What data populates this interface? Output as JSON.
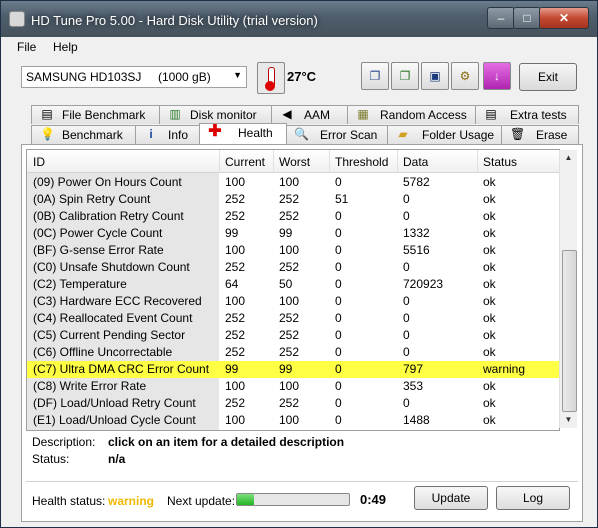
{
  "window": {
    "title": "HD Tune Pro 5.00 - Hard Disk Utility (trial version)",
    "controls": {
      "minimize": "–",
      "maximize": "□",
      "close": "✕"
    }
  },
  "menu": {
    "file": "File",
    "help": "Help"
  },
  "toolbar": {
    "drive": "SAMSUNG HD103SJ",
    "drive_size": "(1000 gB)",
    "temperature": "27°C",
    "exit_label": "Exit",
    "icons": [
      "copy-text-icon",
      "copy-screenshot-icon",
      "save-icon",
      "options-icon",
      "download-icon"
    ]
  },
  "tabs": {
    "top": [
      {
        "label": "File Benchmark",
        "icon": "file-benchmark-icon"
      },
      {
        "label": "Disk monitor",
        "icon": "disk-monitor-icon"
      },
      {
        "label": "AAM",
        "icon": "speaker-icon"
      },
      {
        "label": "Random Access",
        "icon": "random-access-icon"
      },
      {
        "label": "Extra tests",
        "icon": "extra-tests-icon"
      }
    ],
    "bottom": [
      {
        "label": "Benchmark",
        "icon": "benchmark-icon"
      },
      {
        "label": "Info",
        "icon": "info-icon"
      },
      {
        "label": "Health",
        "icon": "health-cross-icon",
        "active": true
      },
      {
        "label": "Error Scan",
        "icon": "error-scan-icon"
      },
      {
        "label": "Folder Usage",
        "icon": "folder-icon"
      },
      {
        "label": "Erase",
        "icon": "trash-icon"
      }
    ]
  },
  "table": {
    "columns": [
      "ID",
      "Current",
      "Worst",
      "Threshold",
      "Data",
      "Status"
    ],
    "rows": [
      [
        "(09) Power On Hours Count",
        "100",
        "100",
        "0",
        "5782",
        "ok"
      ],
      [
        "(0A) Spin Retry Count",
        "252",
        "252",
        "51",
        "0",
        "ok"
      ],
      [
        "(0B) Calibration Retry Count",
        "252",
        "252",
        "0",
        "0",
        "ok"
      ],
      [
        "(0C) Power Cycle Count",
        "99",
        "99",
        "0",
        "1332",
        "ok"
      ],
      [
        "(BF) G-sense Error Rate",
        "100",
        "100",
        "0",
        "5516",
        "ok"
      ],
      [
        "(C0) Unsafe Shutdown Count",
        "252",
        "252",
        "0",
        "0",
        "ok"
      ],
      [
        "(C2) Temperature",
        "64",
        "50",
        "0",
        "720923",
        "ok"
      ],
      [
        "(C3) Hardware ECC Recovered",
        "100",
        "100",
        "0",
        "0",
        "ok"
      ],
      [
        "(C4) Reallocated Event Count",
        "252",
        "252",
        "0",
        "0",
        "ok"
      ],
      [
        "(C5) Current Pending Sector",
        "252",
        "252",
        "0",
        "0",
        "ok"
      ],
      [
        "(C6) Offline Uncorrectable",
        "252",
        "252",
        "0",
        "0",
        "ok"
      ],
      [
        "(C7) Ultra DMA CRC Error Count",
        "99",
        "99",
        "0",
        "797",
        "warning"
      ],
      [
        "(C8) Write Error Rate",
        "100",
        "100",
        "0",
        "353",
        "ok"
      ],
      [
        "(DF) Load/Unload Retry Count",
        "252",
        "252",
        "0",
        "0",
        "ok"
      ],
      [
        "(E1) Load/Unload Cycle Count",
        "100",
        "100",
        "0",
        "1488",
        "ok"
      ]
    ],
    "highlight_color": "#ffff44"
  },
  "details": {
    "description_label": "Description:",
    "description_value": "click on an item for a detailed description",
    "status_label": "Status:",
    "status_value": "n/a"
  },
  "footer": {
    "health_label": "Health status:",
    "health_value": "warning",
    "health_color": "#f0b800",
    "next_update_label": "Next update:",
    "next_update_time": "0:49",
    "next_update_progress": 0.15,
    "update_label": "Update",
    "log_label": "Log"
  }
}
